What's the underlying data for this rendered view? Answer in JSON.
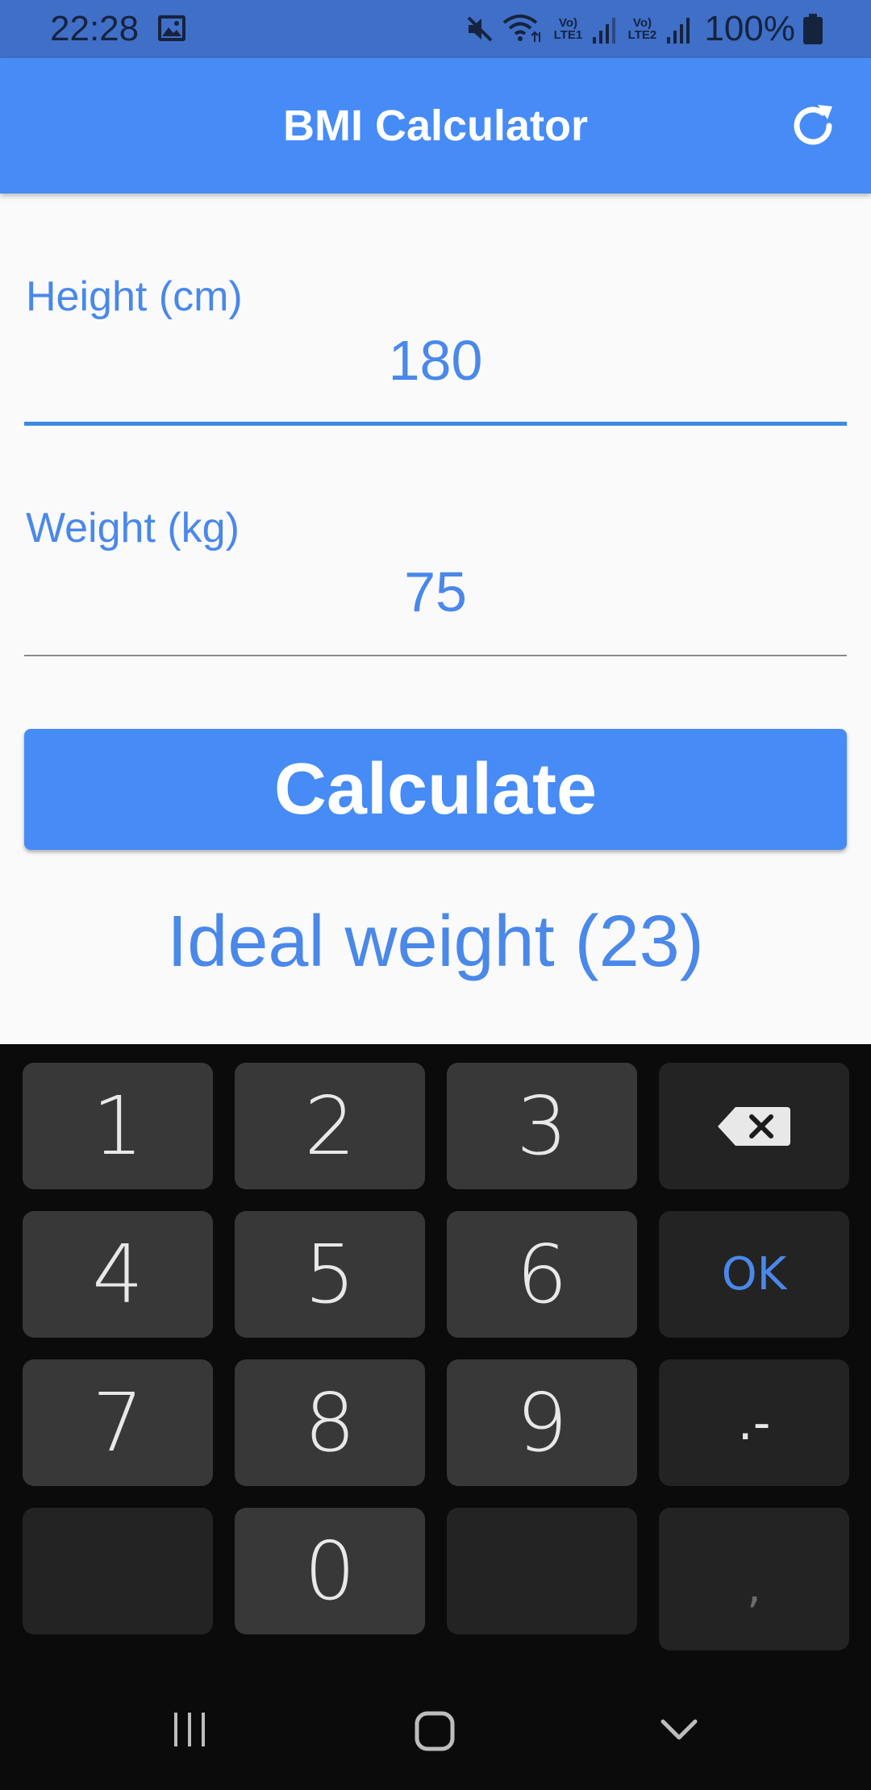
{
  "status_bar": {
    "time": "22:28",
    "battery": "100%",
    "network_1": "Vo) LTE1",
    "network_2": "Vo) LTE2",
    "icons": [
      "gallery-icon",
      "mute-icon",
      "wifi-icon",
      "signal-icon",
      "battery-icon"
    ]
  },
  "app_bar": {
    "title": "BMI Calculator",
    "action_icon": "refresh-icon",
    "color": "#468bf6"
  },
  "form": {
    "height": {
      "label": "Height (cm)",
      "value": "180"
    },
    "weight": {
      "label": "Weight (kg)",
      "value": "75"
    },
    "calculate_label": "Calculate",
    "result": "Ideal weight (23)"
  },
  "keyboard": {
    "row1": [
      "1",
      "2",
      "3"
    ],
    "row2": [
      "4",
      "5",
      "6"
    ],
    "row3": [
      "7",
      "8",
      "9"
    ],
    "zero": "0",
    "ok": "OK",
    "dash": ".-",
    "comma": ",",
    "backspace_icon": "backspace-icon"
  },
  "nav_bar": {
    "icons": [
      "recent-apps-icon",
      "home-icon",
      "back-icon"
    ]
  }
}
